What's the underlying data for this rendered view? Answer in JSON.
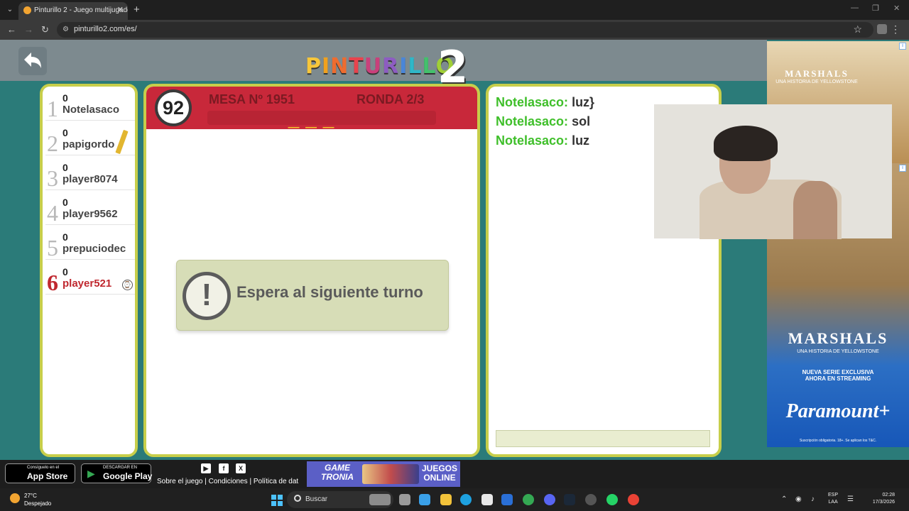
{
  "browser": {
    "tab_title": "Pinturillo 2 - Juego multijugador",
    "tab_close": "✕",
    "new_tab": "+",
    "url": "pinturillo2.com/es/",
    "window_controls": [
      "—",
      "❐",
      "✕"
    ]
  },
  "header": {
    "logo_letters": [
      "P",
      "I",
      "N",
      "T",
      "U",
      "R",
      "I",
      "L",
      "L",
      "O"
    ],
    "logo_colors": [
      "#f7c63a",
      "#f0a11f",
      "#ee6c2f",
      "#e8434d",
      "#c9407b",
      "#8d5cc2",
      "#4a86d8",
      "#2fb7c8",
      "#43c16c",
      "#a0cf36"
    ],
    "logo_number": "2",
    "back_icon": "back-arrow-icon"
  },
  "players": [
    {
      "rank": "1",
      "score": "0",
      "name": "Notelasaco"
    },
    {
      "rank": "2",
      "score": "0",
      "name": "papigordo",
      "drawing": true
    },
    {
      "rank": "3",
      "score": "0",
      "name": "player8074"
    },
    {
      "rank": "4",
      "score": "0",
      "name": "player9562"
    },
    {
      "rank": "5",
      "score": "0",
      "name": "prepuciodec"
    },
    {
      "rank": "6",
      "score": "0",
      "name": "player521",
      "current": true
    }
  ],
  "game": {
    "timer": "92",
    "mesa": "MESA Nº 1951",
    "ronda": "RONDA 2/3",
    "word_hint": "— — —",
    "notice": "Espera al siguiente turno",
    "notice_icon": "!"
  },
  "chat": {
    "messages": [
      {
        "user": "Notelasaco:",
        "text": "luz}"
      },
      {
        "user": "Notelasaco:",
        "text": "sol"
      },
      {
        "user": "Notelasaco:",
        "text": "luz"
      }
    ],
    "input_value": ""
  },
  "ad": {
    "title": "MARSHALS",
    "subtitle": "UNA HISTORIA DE YELLOWSTONE",
    "tag": "NUEVA SERIE EXCLUSIVA AHORA EN STREAMING",
    "brand": "Paramount+",
    "fine_print": "Suscripción obligatoria. 18+. Se aplican los T&C.",
    "info": "i"
  },
  "footer": {
    "appstore_small": "Consíguelo en el",
    "appstore_big": "App Store",
    "gplay_small": "DESCARGAR EN",
    "gplay_big": "Google Play",
    "links": "Sobre el juego | Condiciones | Política de dat",
    "gametronia": "GAME TRONIA",
    "juegos_online": "JUEGOS ONLINE",
    "social": [
      "▶",
      "f",
      "X"
    ]
  },
  "taskbar": {
    "temp": "27°C",
    "weather": "Despejado",
    "search": "Buscar",
    "lang1": "ESP",
    "lang2": "LAA",
    "time": "02:28",
    "date": "17/3/2026"
  }
}
